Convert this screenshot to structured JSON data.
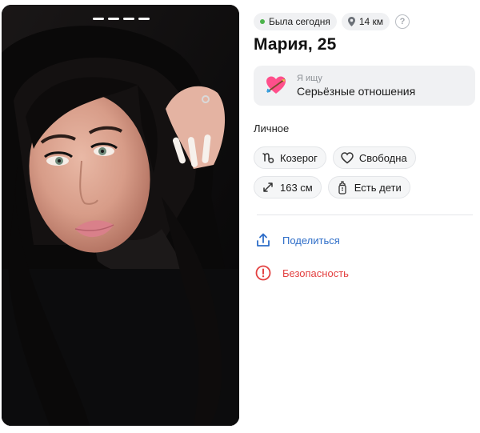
{
  "status": {
    "online_text": "Была сегодня",
    "distance": "14 км",
    "help_glyph": "?",
    "online_color": "#4bb34b"
  },
  "profile": {
    "name_age": "Мария, 25"
  },
  "looking_for": {
    "caption": "Я ищу",
    "value": "Серьёзные отношения",
    "icon": "heart-arrow-icon"
  },
  "personal": {
    "title": "Личное",
    "tags": [
      {
        "label": "Козерог",
        "icon": "capricorn-icon"
      },
      {
        "label": "Свободна",
        "icon": "heart-outline-icon"
      },
      {
        "label": "163 см",
        "icon": "height-arrows-icon"
      },
      {
        "label": "Есть дети",
        "icon": "baby-bottle-icon"
      }
    ]
  },
  "actions": {
    "share_label": "Поделиться",
    "share_color": "#2d6dc8",
    "safety_label": "Безопасность",
    "safety_color": "#e34141"
  },
  "photo": {
    "indicator_count": 4
  }
}
